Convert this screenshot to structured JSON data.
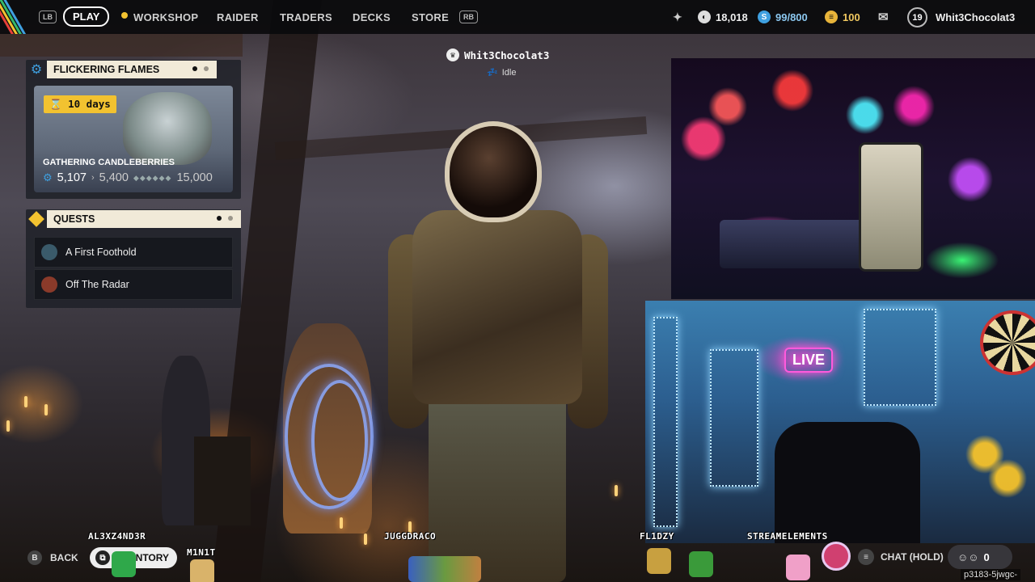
{
  "topbar": {
    "lb": "LB",
    "play": "PLAY",
    "nav": [
      "WORKSHOP",
      "RAIDER",
      "TRADERS",
      "DECKS",
      "STORE"
    ],
    "rb": "RB",
    "stats": {
      "credits": "18,018",
      "raider_tokens": "99/800",
      "coins": "100"
    },
    "level": "19",
    "username": "Whit3Chocolat3"
  },
  "event": {
    "title": "FLICKERING FLAMES",
    "timer": "10 days",
    "task": "GATHERING CANDLEBERRIES",
    "current": "5,107",
    "next": "5,400",
    "max": "15,000",
    "progress_fraction": 0.34
  },
  "quests": {
    "title": "QUESTS",
    "items": [
      {
        "label": "A First Foothold",
        "icon": "raider-portrait-icon",
        "color": "#3a5a6a"
      },
      {
        "label": "Off The Radar",
        "icon": "trader-portrait-icon",
        "color": "#8a3a2a"
      }
    ]
  },
  "player": {
    "name": "Whit3Chocolat3",
    "status": "Idle"
  },
  "bottom": {
    "back_key": "B",
    "back_label": "BACK",
    "inventory_label": "NTORY",
    "overlay_names": [
      "AL3XZ4ND3R",
      "M1N1T",
      "JUGGDRACO",
      "FL1DZY",
      "STREAMELEMENTS"
    ],
    "chat_label": "CHAT (HOLD)",
    "party_count": "0",
    "lobby_code": "p3183-5jwgc-"
  },
  "colors": {
    "accent_yellow": "#f2c230",
    "panel_header": "#f1ead8",
    "credits_blue": "#3fa0e0",
    "coin_gold": "#e8b43a"
  }
}
